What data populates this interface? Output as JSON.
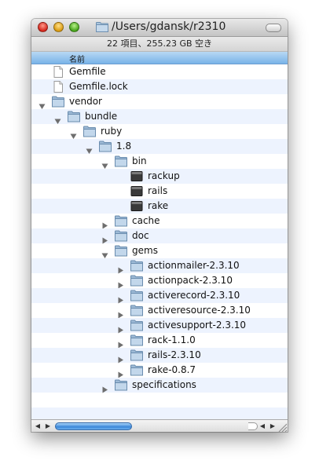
{
  "window": {
    "title": "/Users/gdansk/r2310",
    "status": "22 項目、255.23 GB 空き",
    "column_header": "名前"
  },
  "rows": [
    {
      "label": "Gemfile",
      "level": 0,
      "type": "doc",
      "disclosure": "none"
    },
    {
      "label": "Gemfile.lock",
      "level": 0,
      "type": "doc",
      "disclosure": "none"
    },
    {
      "label": "vendor",
      "level": 0,
      "type": "folder",
      "disclosure": "open"
    },
    {
      "label": "bundle",
      "level": 1,
      "type": "folder",
      "disclosure": "open"
    },
    {
      "label": "ruby",
      "level": 2,
      "type": "folder",
      "disclosure": "open"
    },
    {
      "label": "1.8",
      "level": 3,
      "type": "folder",
      "disclosure": "open"
    },
    {
      "label": "bin",
      "level": 4,
      "type": "folder",
      "disclosure": "open"
    },
    {
      "label": "rackup",
      "level": 5,
      "type": "exec",
      "disclosure": "none"
    },
    {
      "label": "rails",
      "level": 5,
      "type": "exec",
      "disclosure": "none"
    },
    {
      "label": "rake",
      "level": 5,
      "type": "exec",
      "disclosure": "none"
    },
    {
      "label": "cache",
      "level": 4,
      "type": "folder",
      "disclosure": "closed"
    },
    {
      "label": "doc",
      "level": 4,
      "type": "folder",
      "disclosure": "closed"
    },
    {
      "label": "gems",
      "level": 4,
      "type": "folder",
      "disclosure": "open"
    },
    {
      "label": "actionmailer-2.3.10",
      "level": 5,
      "type": "folder",
      "disclosure": "closed"
    },
    {
      "label": "actionpack-2.3.10",
      "level": 5,
      "type": "folder",
      "disclosure": "closed"
    },
    {
      "label": "activerecord-2.3.10",
      "level": 5,
      "type": "folder",
      "disclosure": "closed"
    },
    {
      "label": "activeresource-2.3.10",
      "level": 5,
      "type": "folder",
      "disclosure": "closed"
    },
    {
      "label": "activesupport-2.3.10",
      "level": 5,
      "type": "folder",
      "disclosure": "closed"
    },
    {
      "label": "rack-1.1.0",
      "level": 5,
      "type": "folder",
      "disclosure": "closed"
    },
    {
      "label": "rails-2.3.10",
      "level": 5,
      "type": "folder",
      "disclosure": "closed"
    },
    {
      "label": "rake-0.8.7",
      "level": 5,
      "type": "folder",
      "disclosure": "closed"
    },
    {
      "label": "specifications",
      "level": 4,
      "type": "folder",
      "disclosure": "closed"
    }
  ],
  "icons": {
    "folder": "folder-icon",
    "doc": "document-icon",
    "exec": "executable-icon",
    "open": "disclosure-open-icon",
    "closed": "disclosure-closed-icon"
  }
}
